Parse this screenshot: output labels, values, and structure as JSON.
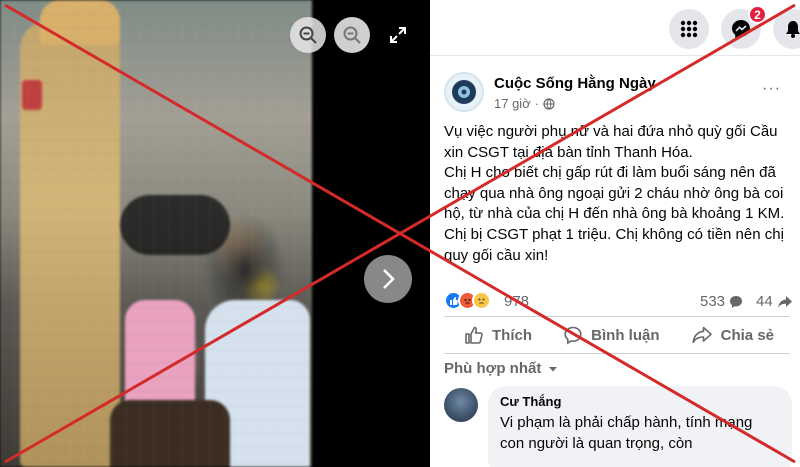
{
  "post": {
    "page_name": "Cuộc Sống Hằng Ngày",
    "time": "17 giờ",
    "more": "···",
    "text_lines": [
      "Vụ việc người phụ nữ và hai đứa nhỏ quỳ gối Cầu xin CSGT tại địa bàn tỉnh Thanh Hóa.",
      "Chị H cho biết chị gấp rút đi làm buổi sáng nên đã chạy qua nhà ông ngoại gửi 2 cháu nhờ ông bà coi hộ, từ nhà của chị H đến nhà ông bà khoảng 1 KM. Chị bị CSGT phạt 1 triệu. Chị không có tiền nên chị quy gối cầu xin!"
    ],
    "reaction_count": "978",
    "comment_count": "533",
    "share_count": "44"
  },
  "actions": {
    "like": "Thích",
    "comment": "Bình luận",
    "share": "Chia sẻ"
  },
  "sort": {
    "label": "Phù hợp nhất"
  },
  "comment": {
    "author": "Cư Thắng",
    "text": "Vi phạm là phải chấp hành, tính mạng con người là quan trọng, còn"
  },
  "topbar": {
    "notification_badge": "2"
  },
  "colors": {
    "fb_blue": "#1877f2",
    "badge_red": "#e41e3f",
    "overlay_red": "#d42a2a"
  },
  "icons": [
    "zoom-out-icon",
    "zoom-in-icon",
    "fullscreen-icon",
    "next-arrow-icon",
    "menu-grid-icon",
    "messenger-icon",
    "bell-icon",
    "globe-icon",
    "like-icon",
    "comment-icon",
    "share-icon",
    "chevron-down-icon"
  ]
}
